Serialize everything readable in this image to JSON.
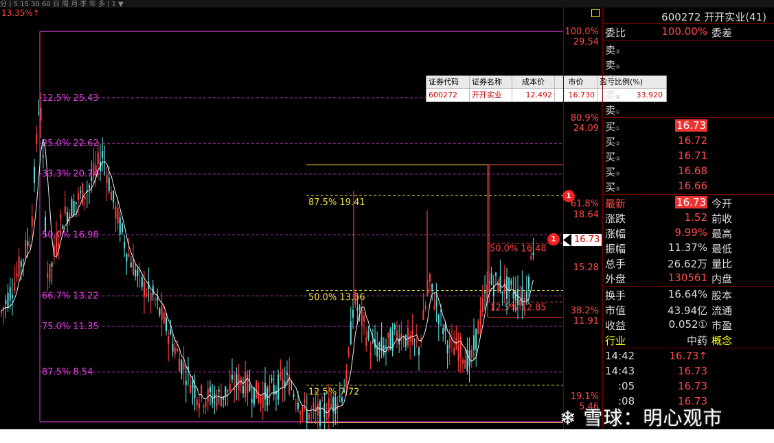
{
  "top": {
    "pct_label": "13.35%↑"
  },
  "table": {
    "headers": [
      "证券代码",
      "证券名称",
      "成本价",
      "市价",
      "盈亏比例(%)"
    ],
    "row": [
      "600272",
      "开开实业",
      "12.492",
      "16.730",
      "33.920"
    ]
  },
  "chart_data": {
    "type": "candlestick",
    "fib_left": {
      "top_level": 29.54,
      "bottom_level": 5.46,
      "levels": [
        {
          "label": "12.5% 25.43",
          "value": 25.43
        },
        {
          "label": "25.0% 22.62",
          "value": 22.62
        },
        {
          "label": "33.3% 20.74",
          "value": 20.74
        },
        {
          "label": "50.0% 16.98",
          "value": 16.98
        },
        {
          "label": "66.7% 13.22",
          "value": 13.22
        },
        {
          "label": "75.0% 11.35",
          "value": 11.35
        },
        {
          "label": "87.5% 8.54",
          "value": 8.54
        }
      ]
    },
    "fib_mid": {
      "levels": [
        {
          "label": "87.5% 19.41",
          "value": 19.41
        },
        {
          "label": "50.0% 13.56",
          "value": 13.56
        },
        {
          "label": "12.5% 7.72",
          "value": 7.72
        }
      ]
    },
    "fib_right": {
      "levels": [
        {
          "label": "50.0% 16.48",
          "value": 16.48
        },
        {
          "label": "12.5% 12.85",
          "value": 12.85
        }
      ]
    },
    "axis_labels": [
      {
        "pct": "100.0%",
        "price": "29.54"
      },
      {
        "pct": "80.9%",
        "price": "24.09"
      },
      {
        "pct": "61.8%",
        "price": "18.64"
      },
      {
        "pct": "",
        "price": "15.28"
      },
      {
        "pct": "38.2%",
        "price": "11.91"
      },
      {
        "pct": "19.1%",
        "price": "5.46"
      }
    ],
    "last_price": "16.73",
    "ylim": [
      5.0,
      31.0
    ]
  },
  "badges": [
    "1",
    "1"
  ],
  "panel": {
    "header": "600272 开开实业(41)",
    "weibi": {
      "label": "委比",
      "value": "100.00%",
      "right": "委差"
    },
    "sell": [
      {
        "label": "卖",
        "n": "⑤"
      },
      {
        "label": "卖",
        "n": "④"
      },
      {
        "label": "卖",
        "n": "③"
      },
      {
        "label": "卖",
        "n": "②"
      },
      {
        "label": "卖",
        "n": "①"
      }
    ],
    "buy": [
      {
        "label": "买",
        "n": "①",
        "value": "16.73"
      },
      {
        "label": "买",
        "n": "②",
        "value": "16.72"
      },
      {
        "label": "买",
        "n": "③",
        "value": "16.71"
      },
      {
        "label": "买",
        "n": "④",
        "value": "16.68"
      },
      {
        "label": "买",
        "n": "⑤",
        "value": "16.66"
      }
    ],
    "stats": [
      {
        "l": "最新",
        "v": "16.73",
        "r": "今开"
      },
      {
        "l": "涨跌",
        "v": "1.52",
        "r": "前收"
      },
      {
        "l": "涨幅",
        "v": "9.99%",
        "r": "最高"
      },
      {
        "l": "振幅",
        "v": "11.37%",
        "r": "最低"
      },
      {
        "l": "总手",
        "v": "26.62万",
        "r": "量比"
      },
      {
        "l": "外盘",
        "v": "130561",
        "r": "内盘"
      }
    ],
    "info": [
      {
        "l": "换手",
        "v": "16.64%",
        "r": "股本"
      },
      {
        "l": "市值",
        "v": "43.94亿",
        "r": "流通"
      },
      {
        "l": "收益",
        "v": "0.052①",
        "r": "市盈"
      },
      {
        "l": "行业",
        "v": "中药",
        "r": "概念"
      }
    ],
    "ticks": [
      {
        "t": "14:42",
        "p": "16.73↑"
      },
      {
        "t": "14:43",
        "p": "16.73"
      },
      {
        "t": ":05",
        "p": "16.73"
      },
      {
        "t": ":08",
        "p": "16.73"
      }
    ]
  },
  "watermark": "雪球：明心观市"
}
